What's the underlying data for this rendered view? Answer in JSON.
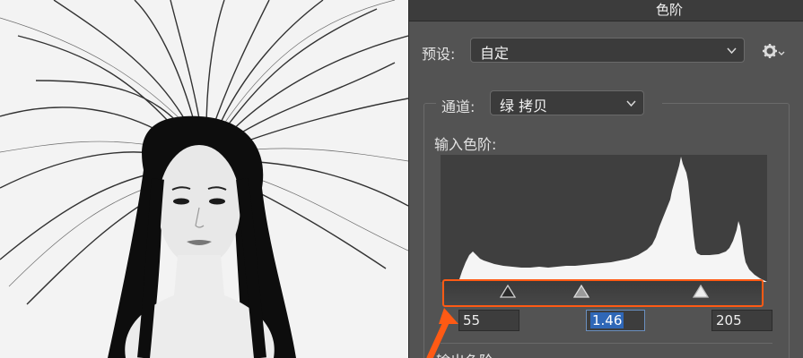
{
  "dialog": {
    "title": "色阶"
  },
  "preset": {
    "label": "预设:",
    "value": "自定"
  },
  "channel": {
    "label": "通道:",
    "value": "绿 拷贝"
  },
  "input_levels": {
    "label": "输入色阶:",
    "black": "55",
    "gamma": "1.46",
    "white": "205"
  },
  "output_levels": {
    "label": "输出色阶:"
  },
  "icons": {
    "gear": "gear-icon",
    "chevron": "chevron-down-icon",
    "arrow": "orange-arrow-icon"
  },
  "colors": {
    "highlight": "#ff5a14",
    "selection": "#2f67b7"
  }
}
